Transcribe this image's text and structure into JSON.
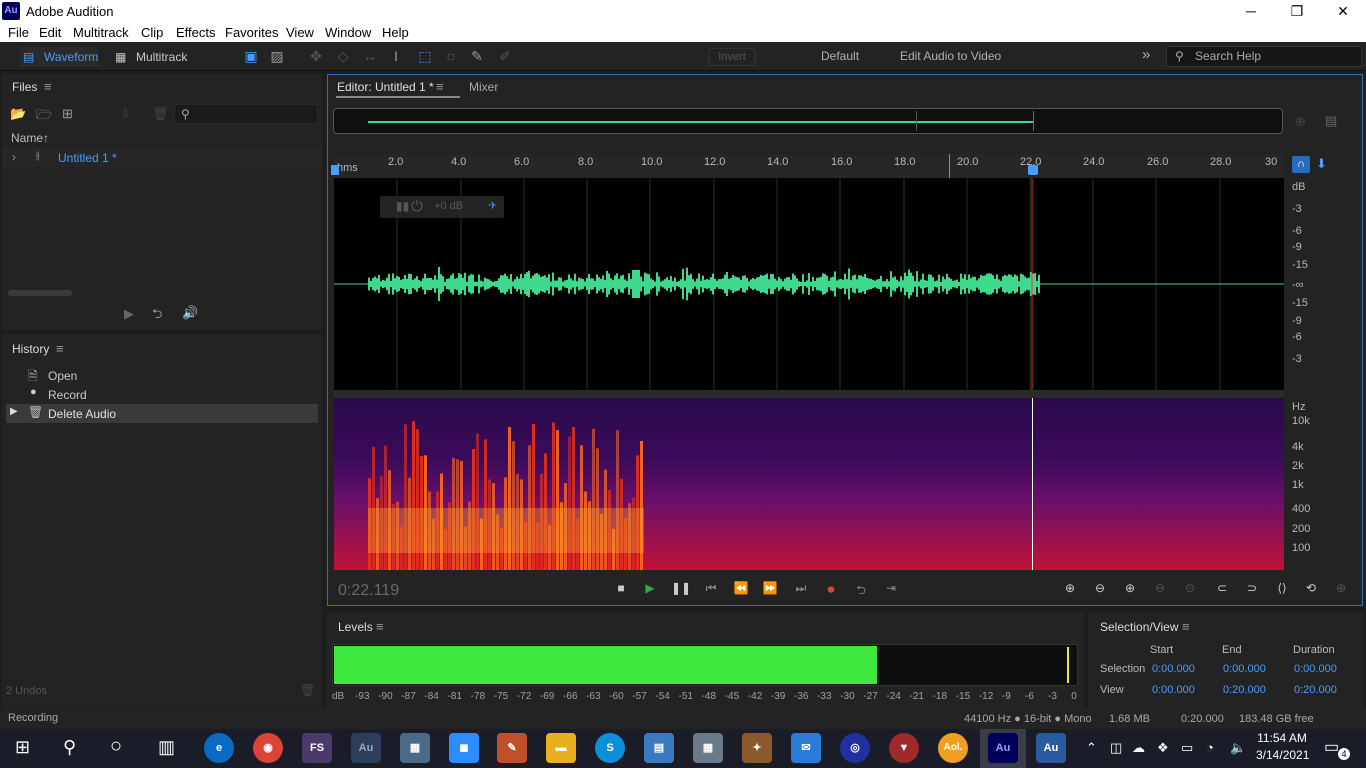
{
  "window": {
    "title": "Adobe Audition",
    "logo": "Au",
    "minimize": "─",
    "restore": "❐",
    "close": "✕"
  },
  "menu": [
    "File",
    "Edit",
    "Multitrack",
    "Clip",
    "Effects",
    "Favorites",
    "View",
    "Window",
    "Help"
  ],
  "toolbar": {
    "waveform": "Waveform",
    "multitrack": "Multitrack",
    "invert": "Invert",
    "workspace_default": "Default",
    "workspace_edit": "Edit Audio to Video",
    "more": "»",
    "search_placeholder": "Search Help"
  },
  "files": {
    "title": "Files",
    "column_name": "Name",
    "sort_arrow": "↑",
    "item": "Untitled 1 *"
  },
  "history": {
    "title": "History",
    "items": [
      "Open",
      "Record",
      "Delete Audio"
    ],
    "undos": "2 Undos"
  },
  "editor": {
    "tab_editor": "Editor: Untitled 1 *",
    "tab_mixer": "Mixer",
    "ruler_unit": "hms",
    "ruler_ticks": [
      "2.0",
      "4.0",
      "6.0",
      "8.0",
      "10.0",
      "12.0",
      "14.0",
      "16.0",
      "18.0",
      "20.0",
      "22.0",
      "24.0",
      "26.0",
      "28.0",
      "30"
    ],
    "hud_gain": "+0 dB",
    "db_labels": [
      "dB",
      "-3",
      "-6",
      "-9",
      "-15",
      "-∞",
      "-15",
      "-9",
      "-6",
      "-3"
    ],
    "hz_labels": [
      "Hz",
      "10k",
      "4k",
      "2k",
      "1k",
      "400",
      "200",
      "100"
    ],
    "current_time": "0:22.119"
  },
  "levels": {
    "title": "Levels",
    "meter_level_fraction": 0.73,
    "scale": [
      "dB",
      "-93",
      "-90",
      "-87",
      "-84",
      "-81",
      "-78",
      "-75",
      "-72",
      "-69",
      "-66",
      "-63",
      "-60",
      "-57",
      "-54",
      "-51",
      "-48",
      "-45",
      "-42",
      "-39",
      "-36",
      "-33",
      "-30",
      "-27",
      "-24",
      "-21",
      "-18",
      "-15",
      "-12",
      "-9",
      "-6",
      "-3",
      "0"
    ]
  },
  "selview": {
    "title": "Selection/View",
    "headers": [
      "Start",
      "End",
      "Duration"
    ],
    "selection_label": "Selection",
    "view_label": "View",
    "selection": [
      "0:00.000",
      "0:00.000",
      "0:00.000"
    ],
    "view": [
      "0:00.000",
      "0:20.000",
      "0:20.000"
    ]
  },
  "status": {
    "left": "Recording",
    "format": "44100 Hz ● 16-bit ● Mono",
    "size": "1.68 MB",
    "duration": "0:20.000",
    "free": "183.48 GB free"
  },
  "taskbar": {
    "time": "11:54 AM",
    "date": "3/14/2021",
    "notifications": "4",
    "apps": [
      "FS",
      "Au",
      "Au",
      "Aol."
    ]
  },
  "colors": {
    "accent": "#2f6fb0",
    "waveform": "#3fd98e",
    "meter": "#3ee83e",
    "playhead": "#ff2a2a"
  }
}
